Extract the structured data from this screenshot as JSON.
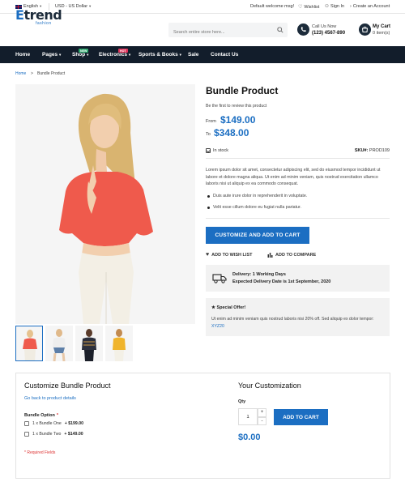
{
  "topbar": {
    "language": "English",
    "currency": "USD - US Dollar",
    "welcome": "Default welcome msg!",
    "wishlist": "Wishlist",
    "sign_in": "Sign In",
    "create_account": "Create an Account"
  },
  "header": {
    "logo_main": "trend",
    "logo_first": "E",
    "logo_sub": "fashion",
    "search_placeholder": "Search entire store here...",
    "call_label": "Call Us Now",
    "call_number": "(123) 4567-890",
    "cart_label": "My Cart",
    "cart_count": "0 item(s)"
  },
  "nav": {
    "items": [
      {
        "label": "Home"
      },
      {
        "label": "Pages"
      },
      {
        "label": "Shop",
        "badge": "NEW",
        "badge_color": "#2ca76c"
      },
      {
        "label": "Electronics",
        "badge": "HOT",
        "badge_color": "#e0355b"
      },
      {
        "label": "Sports & Books"
      },
      {
        "label": "Sale"
      },
      {
        "label": "Contact Us"
      }
    ]
  },
  "breadcrumb": {
    "home": "Home",
    "separator": ">",
    "current": "Bundle Product"
  },
  "product": {
    "title": "Bundle Product",
    "review_prompt": "Be the first to review this product",
    "from_label": "From",
    "from_price": "$149.00",
    "to_label": "To",
    "to_price": "$348.00",
    "stock": "In stock",
    "sku_label": "SKU#:",
    "sku_value": "PROD109",
    "description": "Lorem ipsum dolor sit amet, consectetur adipiscing elit, sed do eiusmod tempor incididunt ut labore et dolore magna aliqua. Ut enim ad minim veniam, quis nostrud exercitation ullamco laboris nisi ut aliquip ex ea commodo consequat.",
    "bullets": [
      "Duis aute irure dolor in reprehenderit in voluptate.",
      "Velit esse cillum dolore eu fugiat nulla pariatur."
    ],
    "customize_button": "CUSTOMIZE AND ADD TO CART",
    "wishlist_action": "ADD TO WISH LIST",
    "compare_action": "ADD TO COMPARE",
    "delivery_line1": "Delivery: 1 Working Days",
    "delivery_line2": "Expected Delivery Date is 1st September, 2020",
    "offer_title": "Special Offer!",
    "offer_text": "Ut enim ad minim veniam quis nostrud laboris nisi 20% off. Sed aliquip ex dolor tempor:",
    "offer_code": "XYZ20"
  },
  "bundle": {
    "title": "Customize Bundle Product",
    "back_link": "Go back to product details",
    "option_label": "Bundle Option",
    "required_mark": "*",
    "options": [
      {
        "label": "1 x Bundle One",
        "price": "+ $199.00"
      },
      {
        "label": "1 x Bundle Two",
        "price": "+ $149.00"
      }
    ],
    "required_fields": "* Required Fields",
    "your_title": "Your Customization",
    "qty_label": "Qty",
    "qty_value": "1",
    "add_button": "ADD TO CART",
    "total": "$0.00"
  },
  "colors": {
    "accent": "#1b6ec2",
    "nav_bg": "#121d2b",
    "required": "#d33"
  }
}
